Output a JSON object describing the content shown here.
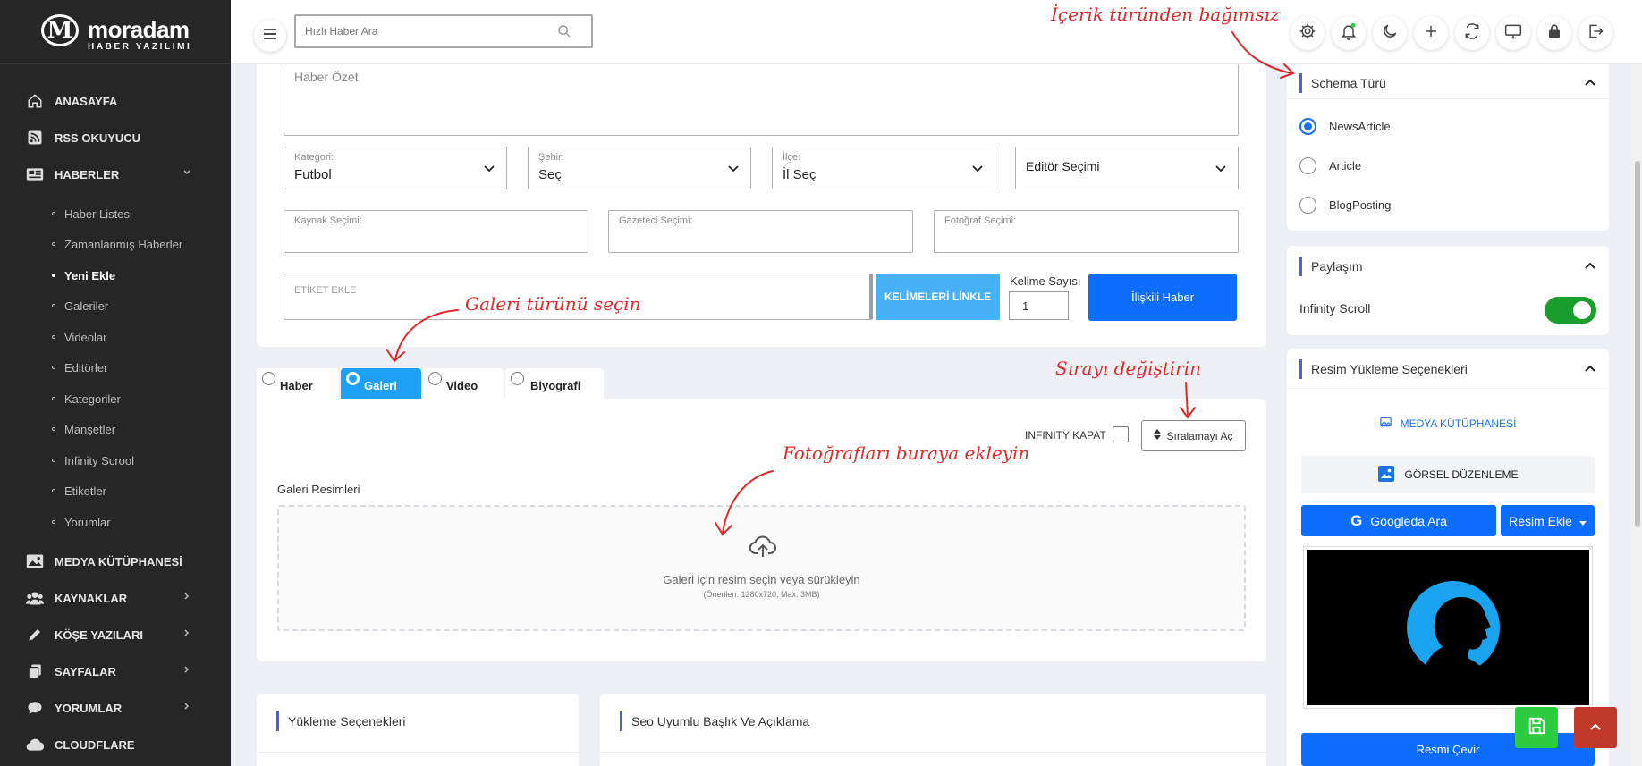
{
  "brand": {
    "name": "moradam",
    "subtitle": "HABER YAZILIMI",
    "logo_letter": "M"
  },
  "sidebar": {
    "items": [
      {
        "label": "ANASAYFA",
        "icon": "home-icon"
      },
      {
        "label": "RSS OKUYUCU",
        "icon": "rss-icon"
      },
      {
        "label": "HABERLER",
        "icon": "newspaper-icon"
      },
      {
        "label": "MEDYA KÜTÜPHANESİ",
        "icon": "image-icon"
      },
      {
        "label": "KAYNAKLAR",
        "icon": "users-icon"
      },
      {
        "label": "KÖŞE YAZILARI",
        "icon": "pen-icon"
      },
      {
        "label": "SAYFALAR",
        "icon": "copy-icon"
      },
      {
        "label": "YORUMLAR",
        "icon": "comment-icon"
      },
      {
        "label": "CLOUDFLARE",
        "icon": "cloud-icon"
      }
    ],
    "sub_items": [
      "Haber Listesi",
      "Zamanlanmış Haberler",
      "Yeni Ekle",
      "Galeriler",
      "Videolar",
      "Editörler",
      "Kategoriler",
      "Manşetler",
      "Infinity Scrool",
      "Etiketler",
      "Yorumlar"
    ],
    "active_sub": "Yeni Ekle"
  },
  "topbar": {
    "search_placeholder": "Hızlı Haber Ara",
    "icons": [
      "gear-icon",
      "bell-icon",
      "moon-icon",
      "plus-icon",
      "refresh-icon",
      "monitor-icon",
      "lock-icon",
      "logout-icon"
    ]
  },
  "form": {
    "summary_placeholder": "Haber Özet",
    "kategori_label": "Kategori:",
    "kategori_value": "Futbol",
    "sehir_label": "Şehir:",
    "sehir_value": "Seç",
    "ilce_label": "İlçe:",
    "ilce_value": "İl Seç",
    "editor_value": "Editör Seçimi",
    "kaynak_label": "Kaynak Seçimi:",
    "gazeteci_label": "Gazeteci Seçimi:",
    "fotograf_label": "Fotoğraf Seçimi:",
    "etiket_placeholder": "ETİKET EKLE",
    "link_words": "KELİMELERİ LİNKLE",
    "word_count_label": "Kelime Sayısı",
    "word_count_value": "1",
    "related_button": "İlişkili Haber"
  },
  "tabs": [
    {
      "label": "Haber",
      "active": false
    },
    {
      "label": "Galeri",
      "active": true
    },
    {
      "label": "Video",
      "active": false
    },
    {
      "label": "Biyografi",
      "active": false
    }
  ],
  "gallery": {
    "infinity_label": "INFINITY KAPAT",
    "sort_button": "Sıralamayı Aç",
    "title": "Galeri Resimleri",
    "drop_text": "Galeri için resim seçin veya sürükleyin",
    "drop_hint": "(Önerilen: 1280x720, Max: 3MB)"
  },
  "bottom": {
    "upload_title": "Yükleme Seçenekleri",
    "seo_title": "Seo Uyumlu Başlık Ve Açıklama"
  },
  "right": {
    "schema": {
      "title": "Schema Türü",
      "options": [
        "NewsArticle",
        "Article",
        "BlogPosting"
      ],
      "selected": "NewsArticle"
    },
    "share": {
      "title": "Paylaşım",
      "infinity_label": "Infinity Scroll",
      "toggle_on": true
    },
    "image": {
      "title": "Resim Yükleme Seçenekleri",
      "media_library": "MEDYA KÜTÜPHANESİ",
      "edit_image": "GÖRSEL DÜZENLEME",
      "google": "Googleda Ara",
      "add_image": "Resim Ekle",
      "rotate": "Resmi Çevir"
    }
  },
  "annotations": {
    "content_independent": "İçerik türünden bağımsız",
    "choose_gallery": "Galeri türünü seçin",
    "change_order": "Sırayı değiştirin",
    "add_photos": "Fotoğrafları buraya ekleyin"
  },
  "colors": {
    "sidebar": "#262626",
    "primary": "#0d6efd",
    "tab_active": "#1ea1f4",
    "annotation": "#e02a2a",
    "toggle": "#1a9e2c",
    "save": "#2ecc40",
    "top": "#c0392b"
  }
}
